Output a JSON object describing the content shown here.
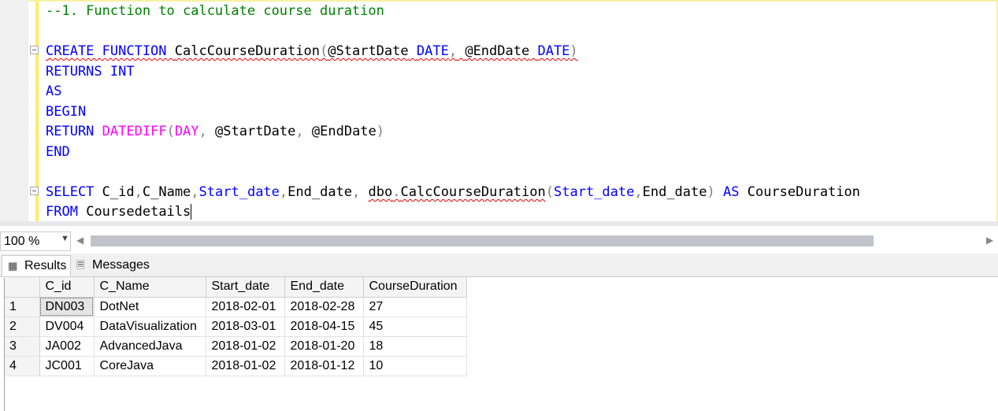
{
  "editor": {
    "lines": {
      "comment": "--1. Function to calculate course duration",
      "create_kw": "CREATE FUNCTION",
      "func_name": "CalcCourseDuration",
      "paren_open": "(",
      "param1": "@StartDate",
      "type1": "DATE",
      "comma1": ",",
      "param2": "@EndDate",
      "type2": "DATE",
      "paren_close": ")",
      "returns_kw": "RETURNS INT",
      "as_kw": "AS",
      "begin_kw": "BEGIN",
      "return_kw": "RETURN",
      "datediff_fn": "DATEDIFF",
      "datediff_open": "(",
      "day_kw": "DAY",
      "comma2": ",",
      "arg1": "@StartDate",
      "comma3": ",",
      "arg2": "@EndDate",
      "datediff_close": ")",
      "end_kw": "END",
      "select_kw": "SELECT",
      "col_cid": "C_id",
      "comma4": ",",
      "col_cname": "C_Name",
      "comma5": ",",
      "col_start": "Start_date",
      "comma6": ",",
      "col_end": "End_date",
      "comma7": ",",
      "dbo_name": "dbo",
      "dot": ".",
      "call_name": "CalcCourseDuration",
      "call_open": "(",
      "call_arg1": "Start_date",
      "comma8": ",",
      "call_arg2": "End_date",
      "call_close": ")",
      "as_alias_kw": "AS",
      "alias": "CourseDuration",
      "from_kw": "FROM",
      "table_name": "Coursedetails"
    }
  },
  "zoom": {
    "value": "100 %"
  },
  "tabs": [
    {
      "label": "Results",
      "icon": "grid-icon"
    },
    {
      "label": "Messages",
      "icon": "messages-icon"
    }
  ],
  "grid": {
    "columns": [
      "C_id",
      "C_Name",
      "Start_date",
      "End_date",
      "CourseDuration"
    ],
    "rows": [
      {
        "num": "1",
        "cells": [
          "DN003",
          "DotNet",
          "2018-02-01",
          "2018-02-28",
          "27"
        ]
      },
      {
        "num": "2",
        "cells": [
          "DV004",
          "DataVisualization",
          "2018-03-01",
          "2018-04-15",
          "45"
        ]
      },
      {
        "num": "3",
        "cells": [
          "JA002",
          "AdvancedJava",
          "2018-01-02",
          "2018-01-20",
          "18"
        ]
      },
      {
        "num": "4",
        "cells": [
          "JC001",
          "CoreJava",
          "2018-01-02",
          "2018-01-12",
          "10"
        ]
      }
    ]
  },
  "colors": {
    "keyword": "#0000ff",
    "comment": "#008000",
    "function": "#ff00ff",
    "operator": "#808080",
    "change_bar": "#ffee62"
  }
}
